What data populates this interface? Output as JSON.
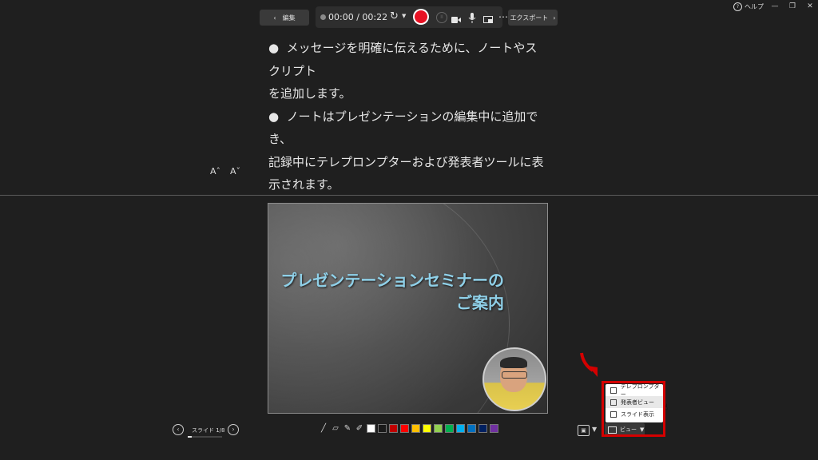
{
  "window": {
    "help_label": "ヘルプ"
  },
  "toolbar": {
    "edit_label": "編集",
    "time_current": "00:00",
    "time_separator": "/",
    "time_total": "00:22",
    "more_label": "…",
    "export_label": "エクスポート"
  },
  "notes": {
    "lines": [
      "メッセージを明確に伝えるために、ノートやスクリプト",
      "を追加します。",
      "ノートはプレゼンテーションの編集中に追加でき、",
      "記録中にテレプロンプターおよび発表者ツールに表",
      "示されます。"
    ],
    "font_increase": "Aˆ",
    "font_decrease": "Aˇ"
  },
  "slide": {
    "title_line1": "プレゼンテーションセミナーの",
    "title_line2": "ご案内"
  },
  "bottom": {
    "slide_counter": "スライド 1/8",
    "progress": 0.125,
    "colors": [
      "#ffffff",
      "#1a1a1a",
      "#c00000",
      "#ff0000",
      "#ffc000",
      "#ffff00",
      "#92d050",
      "#00b050",
      "#00b0f0",
      "#0070c0",
      "#002060",
      "#7030a0"
    ],
    "view_label": "ビュー",
    "view_caret": "▼"
  },
  "view_menu": {
    "items": [
      "テレプロンプター",
      "発表者ビュー",
      "スライド表示"
    ]
  }
}
